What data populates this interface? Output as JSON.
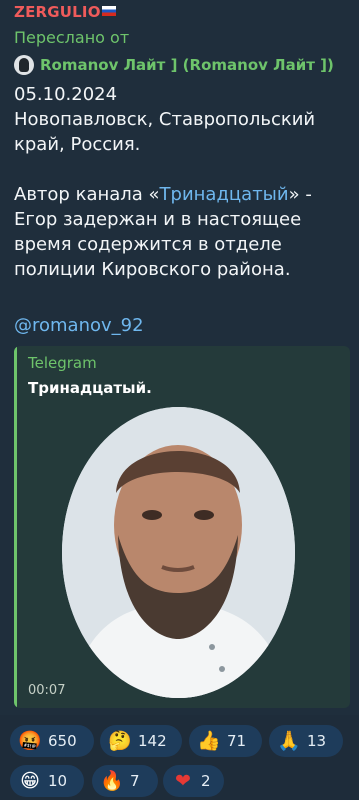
{
  "message": {
    "sender": "ZERGULIO",
    "forwarded_label": "Переслано от",
    "forwarded_from": "Romanov Лайт ] (Romanov Лайт ])",
    "date": "05.10.2024",
    "location_line1": "Новопавловск, Ставропольский",
    "location_line2": "край, Россия.",
    "body_line1_prefix": "Автор канала «",
    "body_line1_link": "Тринадцатый",
    "body_line1_suffix": "» -",
    "body_line2": "Егор задержан и в настоящее",
    "body_line3": "время содержится в отделе",
    "body_line4": "полиции Кировского района.",
    "mention": "@romanov_92"
  },
  "link_preview": {
    "site_name": "Telegram",
    "title": "Тринадцатый.",
    "video_duration": "00:07"
  },
  "reactions": [
    {
      "emoji_name": "swearing-face-icon",
      "glyph": "🤬",
      "count": "650"
    },
    {
      "emoji_name": "thinking-face-icon",
      "glyph": "🤔",
      "count": "142"
    },
    {
      "emoji_name": "thumbs-up-icon",
      "glyph": "👍",
      "count": "71"
    },
    {
      "emoji_name": "praying-hands-icon",
      "glyph": "🙏",
      "count": "13"
    },
    {
      "emoji_name": "grinning-face-icon",
      "glyph": "😁",
      "count": "10"
    },
    {
      "emoji_name": "fire-icon",
      "glyph": "🔥",
      "count": "7"
    },
    {
      "emoji_name": "red-heart-icon",
      "glyph": "❤",
      "count": "2"
    }
  ],
  "colors": {
    "sender": "#ef5b5b",
    "forward": "#6ec46b",
    "link": "#6fb7ee",
    "reaction_pill": "#1e3c5b"
  }
}
